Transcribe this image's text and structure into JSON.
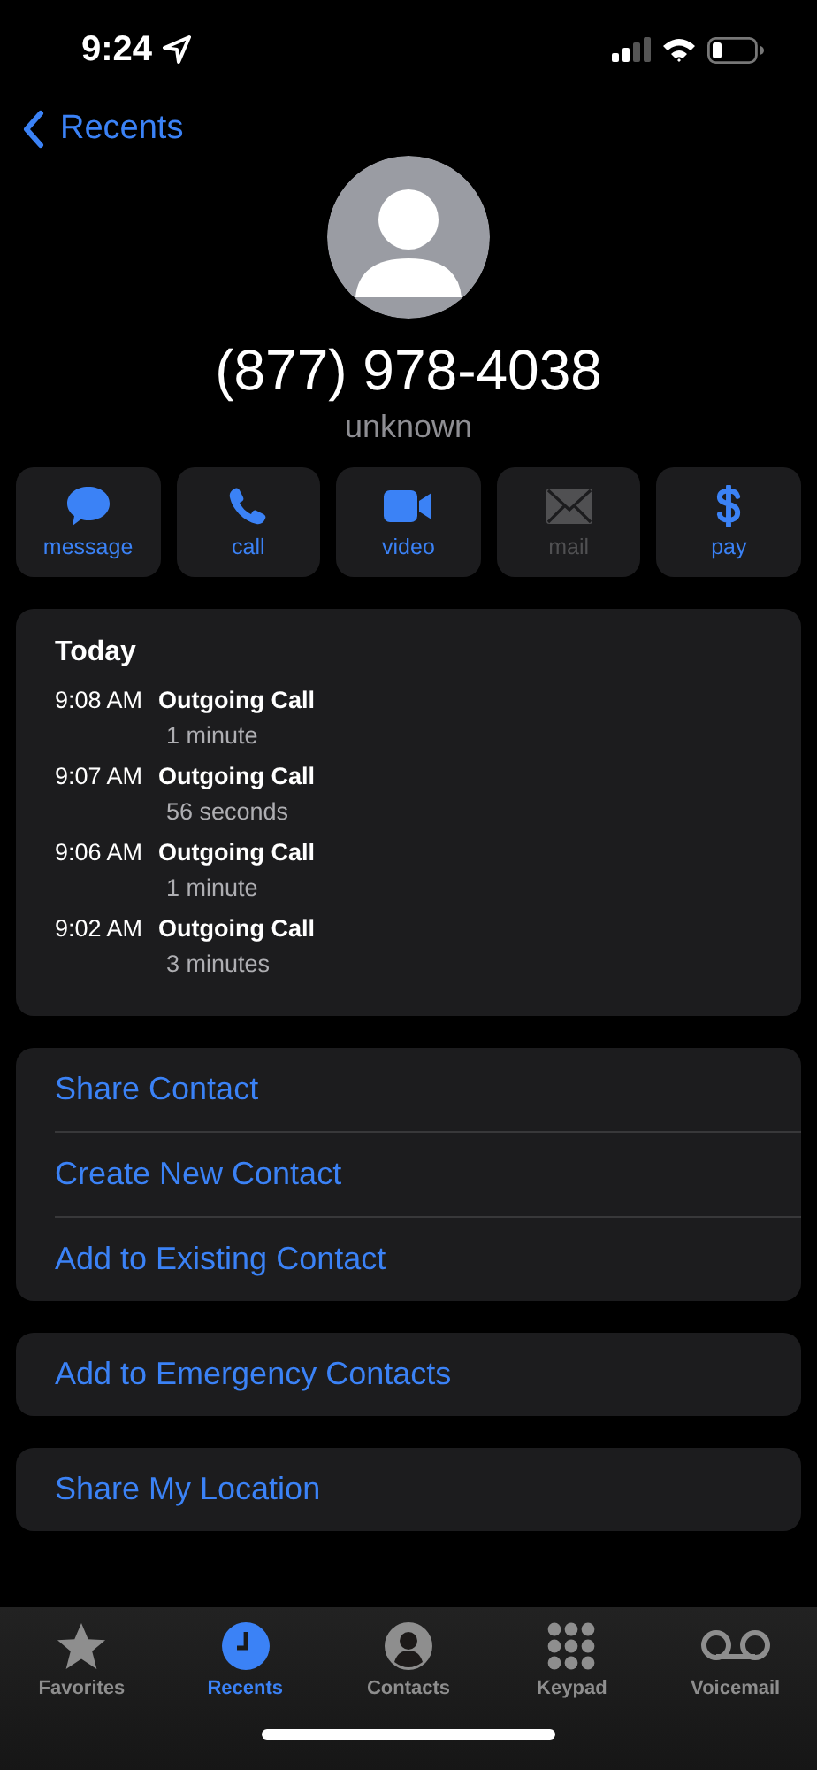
{
  "status_bar": {
    "time": "9:24"
  },
  "nav": {
    "back_label": "Recents"
  },
  "contact": {
    "number": "(877) 978-4038",
    "label": "unknown"
  },
  "actions": [
    {
      "kind": "message",
      "label": "message",
      "disabled": false
    },
    {
      "kind": "call",
      "label": "call",
      "disabled": false
    },
    {
      "kind": "video",
      "label": "video",
      "disabled": false
    },
    {
      "kind": "mail",
      "label": "mail",
      "disabled": true
    },
    {
      "kind": "pay",
      "label": "pay",
      "disabled": false
    }
  ],
  "call_history": {
    "heading": "Today",
    "calls": [
      {
        "time": "9:08 AM",
        "type": "Outgoing Call",
        "duration": "1 minute"
      },
      {
        "time": "9:07 AM",
        "type": "Outgoing Call",
        "duration": "56 seconds"
      },
      {
        "time": "9:06 AM",
        "type": "Outgoing Call",
        "duration": "1 minute"
      },
      {
        "time": "9:02 AM",
        "type": "Outgoing Call",
        "duration": "3 minutes"
      }
    ]
  },
  "option_groups": [
    [
      "Share Contact",
      "Create New Contact",
      "Add to Existing Contact"
    ],
    [
      "Add to Emergency Contacts"
    ],
    [
      "Share My Location"
    ]
  ],
  "tab_bar": [
    {
      "kind": "favorites",
      "label": "Favorites",
      "selected": false
    },
    {
      "kind": "recents",
      "label": "Recents",
      "selected": true
    },
    {
      "kind": "contacts",
      "label": "Contacts",
      "selected": false
    },
    {
      "kind": "keypad",
      "label": "Keypad",
      "selected": false
    },
    {
      "kind": "voicemail",
      "label": "Voicemail",
      "selected": false
    }
  ]
}
